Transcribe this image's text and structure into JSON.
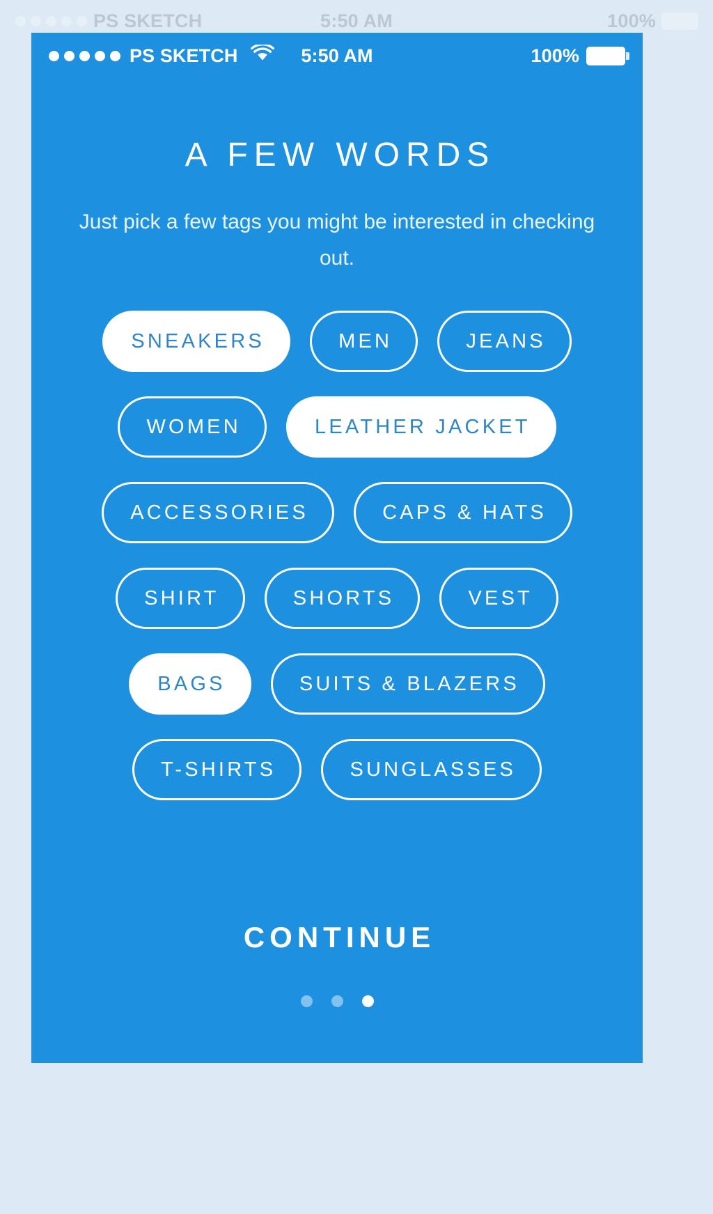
{
  "statusbar": {
    "signal_dots": 5,
    "carrier": "PS SKETCH",
    "wifi_icon": "wifi-icon",
    "time": "5:50 AM",
    "battery_percent": "100%",
    "battery_icon": "battery-full-icon"
  },
  "header": {
    "title": "A FEW WORDS",
    "subtitle": "Just pick a few tags you might be interested in checking out."
  },
  "tags": {
    "rows": [
      [
        {
          "label": "SNEAKERS",
          "selected": true
        },
        {
          "label": "MEN",
          "selected": false
        },
        {
          "label": "JEANS",
          "selected": false
        }
      ],
      [
        {
          "label": "WOMEN",
          "selected": false
        },
        {
          "label": "LEATHER JACKET",
          "selected": true
        }
      ],
      [
        {
          "label": "ACCESSORIES",
          "selected": false
        },
        {
          "label": "CAPS & HATS",
          "selected": false
        }
      ],
      [
        {
          "label": "SHIRT",
          "selected": false
        },
        {
          "label": "SHORTS",
          "selected": false
        },
        {
          "label": "VEST",
          "selected": false
        }
      ],
      [
        {
          "label": "BAGS",
          "selected": true
        },
        {
          "label": "SUITS & BLAZERS",
          "selected": false
        }
      ],
      [
        {
          "label": "T-SHIRTS",
          "selected": false
        },
        {
          "label": "SUNGLASSES",
          "selected": false
        }
      ]
    ]
  },
  "footer": {
    "continue_label": "CONTINUE",
    "page_dots": {
      "count": 3,
      "active_index": 2
    }
  },
  "colors": {
    "canvas_background": "#dde9f4",
    "screen_background": "#1e90e0",
    "accent_text": "#ffffff",
    "selected_tag_text": "#2e86c8",
    "subtitle_text": "#eaf4fd"
  }
}
